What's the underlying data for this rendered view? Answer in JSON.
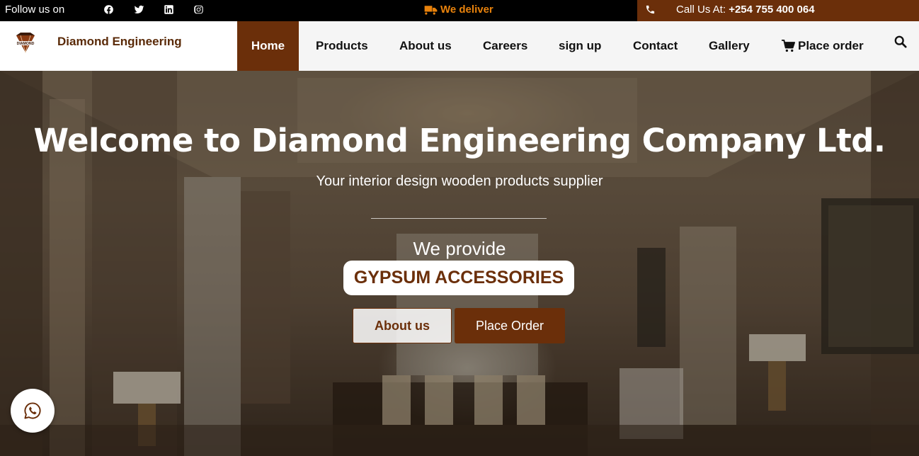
{
  "topbar": {
    "follow_label": "Follow us on",
    "social": [
      "facebook-icon",
      "twitter-icon",
      "linkedin-icon",
      "instagram-icon"
    ],
    "deliver_label": "We deliver",
    "call_label": "Call Us At: ",
    "call_number": "+254 755 400 064"
  },
  "brand": {
    "name": "Diamond Engineering",
    "logo_text": "DIAMOND"
  },
  "nav": {
    "home": "Home",
    "products": "Products",
    "about": "About us",
    "careers": "Careers",
    "signup": "sign up",
    "contact": "Contact",
    "gallery": "Gallery",
    "place_order": "Place order"
  },
  "hero": {
    "title": "Welcome to Diamond Engineering Company Ltd.",
    "subtitle": "Your interior design wooden products supplier",
    "provide_label": "We provide",
    "highlight": "GYPSUM ACCESSORIES",
    "about_button": "About us",
    "order_button": "Place Order"
  },
  "colors": {
    "brand_brown": "#6b2f0a",
    "deliver_orange": "#e8820c",
    "topbar_bg": "#000000"
  }
}
